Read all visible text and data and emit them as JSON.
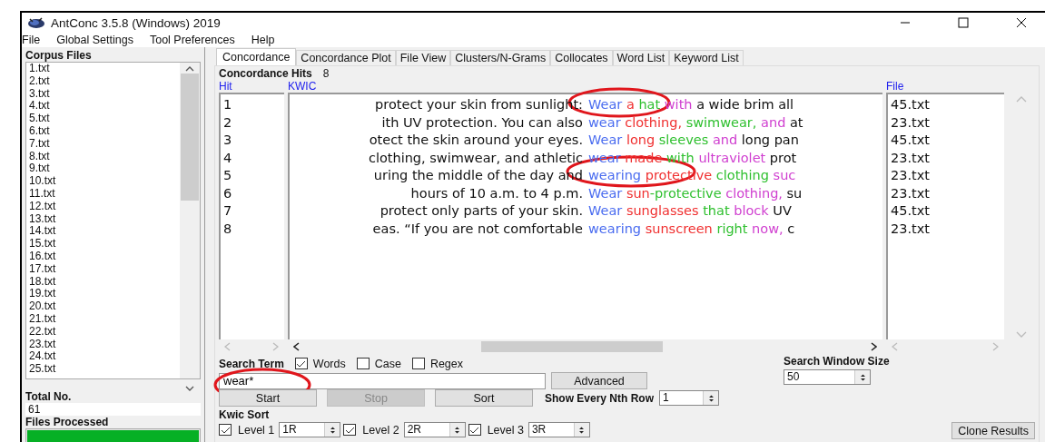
{
  "window": {
    "title": "AntConc 3.5.8 (Windows) 2019"
  },
  "menu": [
    "File",
    "Global Settings",
    "Tool Preferences",
    "Help"
  ],
  "corpus": {
    "label": "Corpus Files",
    "files": [
      "1.txt",
      "2.txt",
      "3.txt",
      "4.txt",
      "5.txt",
      "6.txt",
      "7.txt",
      "8.txt",
      "9.txt",
      "10.txt",
      "11.txt",
      "12.txt",
      "13.txt",
      "14.txt",
      "15.txt",
      "16.txt",
      "17.txt",
      "18.txt",
      "19.txt",
      "20.txt",
      "21.txt",
      "22.txt",
      "23.txt",
      "24.txt",
      "25.txt"
    ],
    "total_label": "Total No.",
    "total": "61",
    "processed_label": "Files Processed",
    "progress": {
      "level": 1
    }
  },
  "tabs": [
    {
      "label": "Concordance",
      "selected": true
    },
    {
      "label": "Concordance Plot",
      "selected": false
    },
    {
      "label": "File View",
      "selected": false
    },
    {
      "label": "Clusters/N-Grams",
      "selected": false
    },
    {
      "label": "Collocates",
      "selected": false
    },
    {
      "label": "Word List",
      "selected": false
    },
    {
      "label": "Keyword List",
      "selected": false
    }
  ],
  "hits": {
    "label": "Concordance Hits",
    "count": "8"
  },
  "table": {
    "columns": [
      "Hit",
      "KWIC",
      "File"
    ],
    "rows": [
      {
        "hit": "1",
        "left": "protect your skin from sunlight:",
        "right": [
          {
            "text": "Wear",
            "color": "#4a6cf0"
          },
          {
            "text": "a",
            "color": "#f03030"
          },
          {
            "text": "hat",
            "color": "#30c030"
          },
          {
            "text": "with",
            "color": "#d040d0"
          },
          {
            "text": "a wide brim all",
            "color": "#111111"
          }
        ],
        "file": "45.txt"
      },
      {
        "hit": "2",
        "left": "ith UV protection. You can also",
        "right": [
          {
            "text": "wear",
            "color": "#4a6cf0"
          },
          {
            "text": "clothing,",
            "color": "#f03030"
          },
          {
            "text": "swimwear,",
            "color": "#30c030"
          },
          {
            "text": "and",
            "color": "#d040d0"
          },
          {
            "text": "at",
            "color": "#111111"
          }
        ],
        "file": "23.txt"
      },
      {
        "hit": "3",
        "left": "otect the skin around your eyes.",
        "right": [
          {
            "text": "Wear",
            "color": "#4a6cf0"
          },
          {
            "text": "long",
            "color": "#f03030"
          },
          {
            "text": "sleeves",
            "color": "#30c030"
          },
          {
            "text": "and",
            "color": "#d040d0"
          },
          {
            "text": "long pan",
            "color": "#111111"
          }
        ],
        "file": "45.txt"
      },
      {
        "hit": "4",
        "left": "clothing, swimwear, and athletic",
        "right": [
          {
            "text": "wear",
            "color": "#4a6cf0"
          },
          {
            "text": "made",
            "color": "#f03030"
          },
          {
            "text": "with",
            "color": "#30c030"
          },
          {
            "text": "ultraviolet",
            "color": "#d040d0"
          },
          {
            "text": "prot",
            "color": "#111111"
          }
        ],
        "file": "23.txt"
      },
      {
        "hit": "5",
        "left": "uring the middle of the day and",
        "right": [
          {
            "text": "wearing",
            "color": "#4a6cf0"
          },
          {
            "text": "protective",
            "color": "#f03030"
          },
          {
            "text": "clothing",
            "color": "#30c030"
          },
          {
            "text": "suc",
            "color": "#d040d0"
          }
        ],
        "file": "23.txt"
      },
      {
        "hit": "6",
        "left": "hours of 10 a.m. to 4 p.m.",
        "right": [
          {
            "text": "Wear",
            "color": "#4a6cf0"
          },
          {
            "text": "sun",
            "color": "#f03030"
          },
          {
            "text": "-protective",
            "color": "#30c030",
            "attach": true
          },
          {
            "text": "clothing,",
            "color": "#d040d0"
          },
          {
            "text": "su",
            "color": "#111111"
          }
        ],
        "file": "23.txt"
      },
      {
        "hit": "7",
        "left": "protect only parts of your skin.",
        "right": [
          {
            "text": "Wear",
            "color": "#4a6cf0"
          },
          {
            "text": "sunglasses",
            "color": "#f03030"
          },
          {
            "text": "that",
            "color": "#30c030"
          },
          {
            "text": "block",
            "color": "#d040d0"
          },
          {
            "text": "UV",
            "color": "#111111"
          }
        ],
        "file": "45.txt"
      },
      {
        "hit": "8",
        "left": "eas. “If you are not comfortable",
        "right": [
          {
            "text": "wearing",
            "color": "#4a6cf0"
          },
          {
            "text": "sunscreen",
            "color": "#f03030"
          },
          {
            "text": "right",
            "color": "#30c030"
          },
          {
            "text": "now,",
            "color": "#d040d0"
          },
          {
            "text": "c",
            "color": "#111111"
          }
        ],
        "file": "23.txt"
      }
    ]
  },
  "search": {
    "label": "Search Term",
    "options": [
      {
        "label": "Words",
        "checked": true
      },
      {
        "label": "Case",
        "checked": false
      },
      {
        "label": "Regex",
        "checked": false
      }
    ],
    "value": "wear*",
    "advanced": "Advanced",
    "window_label": "Search Window Size",
    "window_size": "50"
  },
  "buttons": [
    {
      "label": "Start",
      "disabled": false
    },
    {
      "label": "Stop",
      "disabled": true
    },
    {
      "label": "Sort",
      "disabled": false
    }
  ],
  "nth": {
    "label": "Show Every Nth Row",
    "value": "1"
  },
  "kwic_sort": {
    "label": "Kwic Sort",
    "levels": [
      {
        "label": "Level 1",
        "checked": true,
        "value": "1R"
      },
      {
        "label": "Level 2",
        "checked": true,
        "value": "2R"
      },
      {
        "label": "Level 3",
        "checked": true,
        "value": "3R"
      }
    ]
  },
  "clone": "Clone Results",
  "annotations": [
    {
      "kind": "ellipse"
    },
    {
      "kind": "ellipse"
    },
    {
      "kind": "ellipse"
    }
  ]
}
